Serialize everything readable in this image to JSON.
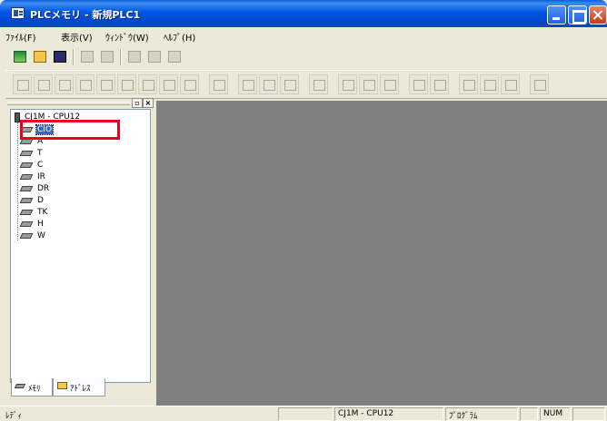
{
  "window": {
    "title": "PLCメモリ - 新規PLC1",
    "icon": "plc-app-icon",
    "controls": [
      "minimize-icon",
      "maximize-icon",
      "close-icon"
    ]
  },
  "menubar": {
    "items": [
      "ﾌｧｲﾙ(F)",
      "表示(V)",
      "ｳｨﾝﾄﾞｳ(W)",
      "ﾍﾙﾌﾟ(H)"
    ]
  },
  "toolbar1": {
    "icons": [
      "new-file-icon",
      "open-folder-icon",
      "save-icon",
      "print-icon",
      "print-preview-icon",
      "cut-icon",
      "copy-icon",
      "paste-icon"
    ]
  },
  "toolbar2": {
    "icons": [
      "tool-1-icon",
      "tool-2-icon",
      "tool-3-icon",
      "tool-4-icon",
      "tool-5-icon",
      "tool-6-icon",
      "tool-7-icon",
      "tool-8-icon",
      "tool-9-icon",
      "tool-10-icon",
      "tool-11-icon",
      "tool-12-icon",
      "tool-13-icon",
      "tool-14-icon",
      "tool-15-icon",
      "tool-16-icon",
      "tool-17-icon",
      "tool-18-icon",
      "tool-19-icon",
      "tool-20-icon",
      "tool-21-icon",
      "tool-22-icon",
      "tool-23-icon"
    ]
  },
  "tree": {
    "root": "CJ1M - CPU12",
    "nodes": [
      "CIO",
      "A",
      "T",
      "C",
      "IR",
      "DR",
      "D",
      "TK",
      "H",
      "W"
    ],
    "selected": "CIO"
  },
  "tabs": {
    "memory": "ﾒﾓﾘ",
    "address": "ｱﾄﾞﾚｽ"
  },
  "status": {
    "ready": "ﾚﾃﾞｨ",
    "device": "CJ1M - CPU12",
    "mode": "ﾌﾟﾛｸﾞﾗﾑ",
    "numlock": "NUM"
  },
  "colors": {
    "titlebar": "#0055e5",
    "selection": "#316ac5",
    "highlight": "#e8001c",
    "workspace": "#808080"
  }
}
